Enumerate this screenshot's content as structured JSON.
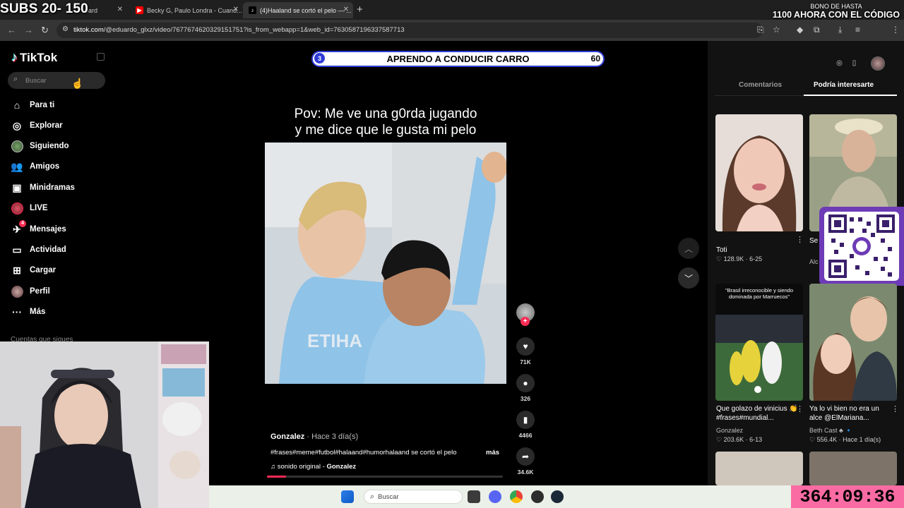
{
  "overlay": {
    "subs_counter": "SUBS 20- 150",
    "promo_line1": "BONO DE HASTA",
    "promo_line2": "1100 AHORA CON EL CÓDIGO",
    "stream_timer": "364:09:36"
  },
  "browser": {
    "tabs": [
      {
        "label": "oard",
        "active": false
      },
      {
        "label": "Becky G, Paulo Londra - Cuand...",
        "active": false
      },
      {
        "label": "(4)Haaland se cortó el pelo — ...",
        "active": true
      }
    ],
    "url_host": "tiktok.com",
    "url_path": "/@eduardo_glxz/video/7677674620329151751?is_from_webapp=1&web_id=7630587196337587713"
  },
  "sidebar": {
    "logo": "TikTok",
    "search_placeholder": "Buscar",
    "items": [
      {
        "label": "Para ti",
        "icon": "home-icon"
      },
      {
        "label": "Explorar",
        "icon": "compass-icon"
      },
      {
        "label": "Siguiendo",
        "icon": "following-avatar-icon"
      },
      {
        "label": "Amigos",
        "icon": "friends-icon"
      },
      {
        "label": "Minidramas",
        "icon": "minidramas-icon"
      },
      {
        "label": "LIVE",
        "icon": "live-icon"
      },
      {
        "label": "Mensajes",
        "icon": "messages-icon",
        "badge": "4"
      },
      {
        "label": "Actividad",
        "icon": "activity-icon"
      },
      {
        "label": "Cargar",
        "icon": "upload-icon"
      },
      {
        "label": "Perfil",
        "icon": "profile-icon"
      },
      {
        "label": "Más",
        "icon": "more-icon"
      }
    ],
    "following_header": "Cuentas que sigues"
  },
  "video": {
    "top_bar_number": "3",
    "top_bar_title": "APRENDO A CONDUCIR CARRO",
    "top_bar_count": "60",
    "caption_line1": "Pov: Me ve una g0rda jugando",
    "caption_line2": "y me dice que le gusta mi pelo",
    "author": "Gonzalez",
    "posted": "· Hace 3 día(s)",
    "description": "#frases#meme#futbol#halaand#humorhalaand se cortó el pelo",
    "more_label": "más",
    "sound": "sonido original - ",
    "sound_author": "Gonzalez",
    "progress": 0.08
  },
  "actions": {
    "likes": "71K",
    "comments": "326",
    "saves": "4466",
    "shares": "34.6K"
  },
  "right_panel": {
    "tab_comments": "Comentarios",
    "tab_suggested": "Podría interesarte",
    "cards": [
      {
        "title": "Toti",
        "author": "",
        "likes": "128.9K",
        "date": "6-25"
      },
      {
        "title": "Se",
        "author": "Alc",
        "likes": "",
        "date": ""
      },
      {
        "title": "Que golazo de vinicius 👏 #frases#mundial...",
        "author": "Gonzalez",
        "likes": "203.6K",
        "date": "6-13"
      },
      {
        "title": "Ya lo vi bien no era un alce @ElMariana...",
        "author": "Beth Cast ♣ 🔹",
        "likes": "556.4K",
        "date": "Hace 1 día(s)"
      }
    ],
    "card3_overlay": "\"Brasil irreconocible y siendo dominada por Marruecos\""
  },
  "taskbar": {
    "search_label": "Buscar"
  },
  "colors": {
    "accent_pink": "#fe2c55",
    "timer_bg": "#fa6ba3",
    "pill_border": "#2f3bd6"
  }
}
